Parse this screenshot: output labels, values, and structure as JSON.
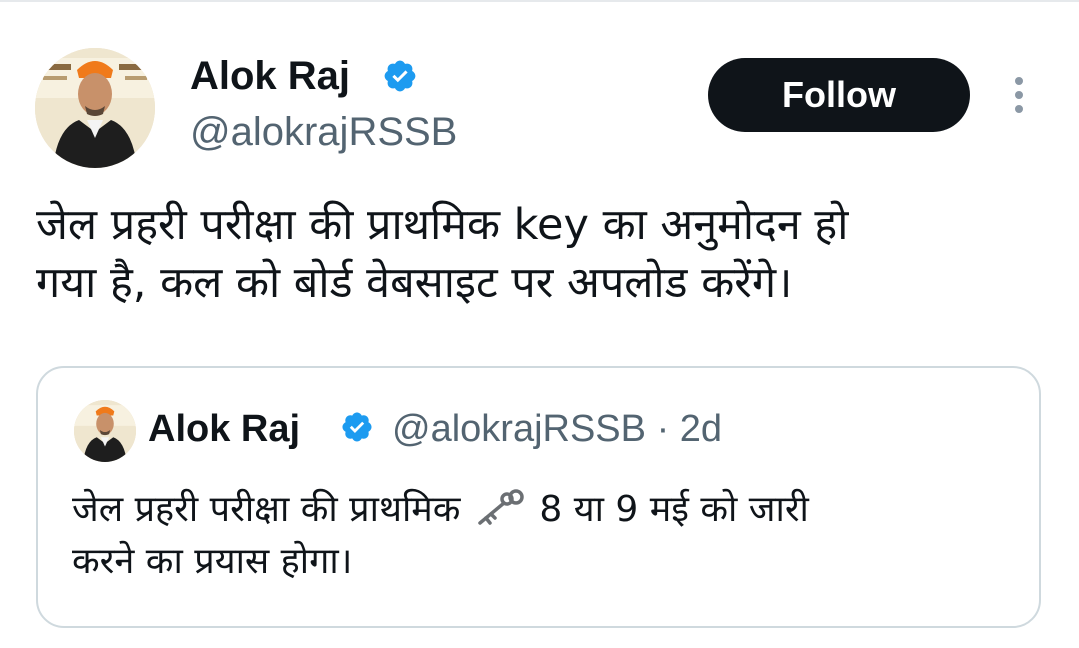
{
  "tweet": {
    "author": {
      "name": "Alok Raj",
      "handle": "@alokrajRSSB",
      "verified": true
    },
    "follow_label": "Follow",
    "text_lines": [
      "जेल प्रहरी परीक्षा की प्राथमिक key का अनुमोदन हो",
      "गया है, कल को बोर्ड वेबसाइट पर अपलोड करेंगे।"
    ]
  },
  "quoted_tweet": {
    "author": {
      "name": "Alok Raj",
      "handle": "@alokrajRSSB",
      "verified": true
    },
    "separator": "·",
    "time": "2d",
    "text_line1_before_icon": "जेल प्रहरी परीक्षा की प्राथमिक",
    "text_line1_after_icon": "8 या 9 मई को जारी",
    "text_line2": "करने का प्रयास होगा।",
    "inline_icon": "key-icon"
  },
  "colors": {
    "verified_blue": "#1d9bf0",
    "follow_bg": "#0f1419",
    "secondary_text": "#536471",
    "border": "#cfd9de"
  }
}
